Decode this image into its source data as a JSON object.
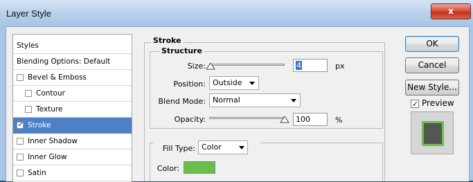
{
  "window": {
    "title": "Layer Style",
    "close_glyph": "x"
  },
  "styles_list": [
    {
      "label": "Styles",
      "checkbox": false,
      "checked": false,
      "selected": false,
      "indent": 0
    },
    {
      "label": "Blending Options: Default",
      "checkbox": false,
      "checked": false,
      "selected": false,
      "indent": 0
    },
    {
      "label": "Bevel & Emboss",
      "checkbox": true,
      "checked": false,
      "selected": false,
      "indent": 0
    },
    {
      "label": "Contour",
      "checkbox": true,
      "checked": false,
      "selected": false,
      "indent": 1
    },
    {
      "label": "Texture",
      "checkbox": true,
      "checked": false,
      "selected": false,
      "indent": 1
    },
    {
      "label": "Stroke",
      "checkbox": true,
      "checked": true,
      "selected": true,
      "indent": 0
    },
    {
      "label": "Inner Shadow",
      "checkbox": true,
      "checked": false,
      "selected": false,
      "indent": 0
    },
    {
      "label": "Inner Glow",
      "checkbox": true,
      "checked": false,
      "selected": false,
      "indent": 0
    },
    {
      "label": "Satin",
      "checkbox": true,
      "checked": false,
      "selected": false,
      "indent": 0
    }
  ],
  "stroke": {
    "section_title": "Stroke",
    "structure_title": "Structure",
    "size": {
      "label": "Size:",
      "value": "4",
      "unit": "px",
      "slider_fraction": 0.02
    },
    "position": {
      "label": "Position:",
      "value": "Outside"
    },
    "blend_mode": {
      "label": "Blend Mode:",
      "value": "Normal"
    },
    "opacity": {
      "label": "Opacity:",
      "value": "100",
      "unit": "%",
      "slider_fraction": 1.0
    },
    "fill_type": {
      "label": "Fill Type:",
      "value": "Color"
    },
    "color": {
      "label": "Color:",
      "swatch": "#6abf4b"
    }
  },
  "buttons": {
    "ok": "OK",
    "cancel": "Cancel",
    "new_style": "New Style..."
  },
  "preview": {
    "label": "Preview",
    "checked": true,
    "check_glyph": "✓"
  },
  "colors": {
    "selection": "#4e80c7",
    "stroke_color": "#6abf4b",
    "preview_fill": "#555555"
  }
}
